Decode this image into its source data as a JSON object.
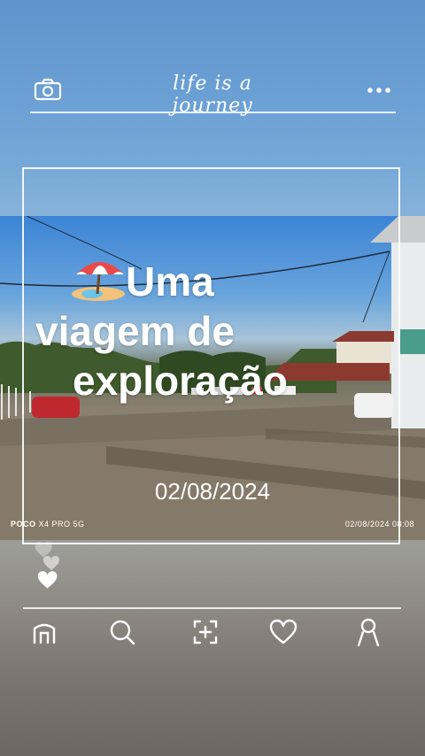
{
  "header": {
    "title": "life is a journey",
    "left_icon": "camera-icon",
    "right_icon": "more-dots-icon"
  },
  "post": {
    "headline_lines": [
      "Uma",
      "viagem de",
      "exploração"
    ],
    "headline_emoji": "beach-umbrella-emoji",
    "date": "02/08/2024",
    "camera_brand": "POCO",
    "camera_model": "X4 PRO 5G",
    "photo_timestamp": "02/08/2024  08:08"
  },
  "nav": {
    "items": [
      {
        "name": "home",
        "icon": "home-icon"
      },
      {
        "name": "search",
        "icon": "search-icon"
      },
      {
        "name": "add",
        "icon": "add-post-icon"
      },
      {
        "name": "likes",
        "icon": "heart-icon"
      },
      {
        "name": "profile",
        "icon": "profile-icon"
      }
    ]
  },
  "colors": {
    "accent": "#ffffff",
    "sky": "#5f94cc"
  }
}
